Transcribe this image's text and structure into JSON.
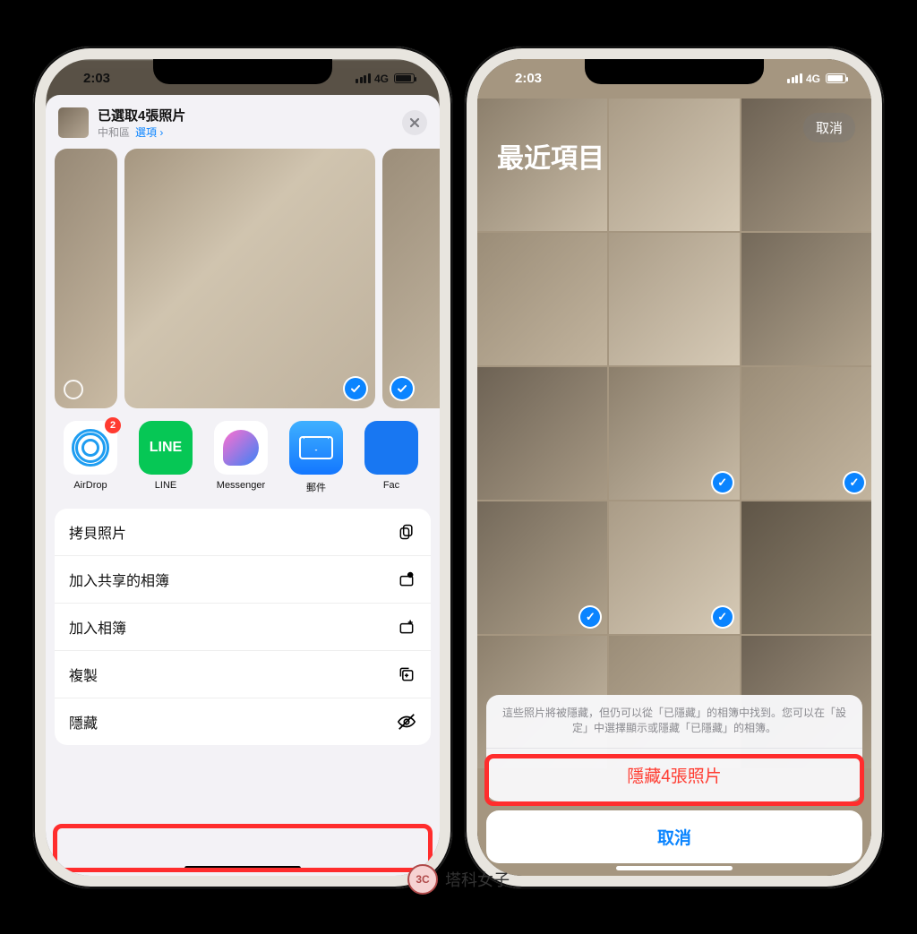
{
  "status": {
    "time": "2:03",
    "network": "4G"
  },
  "phone1": {
    "share": {
      "title": "已選取4張照片",
      "location": "中和區",
      "options_link": "選項 ›"
    },
    "apps": {
      "airdrop": {
        "label": "AirDrop",
        "badge": "2"
      },
      "line": {
        "label": "LINE"
      },
      "messenger": {
        "label": "Messenger"
      },
      "mail": {
        "label": "郵件"
      },
      "facebook": {
        "label": "Fac"
      }
    },
    "actions": {
      "copy_photo": "拷貝照片",
      "add_shared_album": "加入共享的相簿",
      "add_album": "加入相簿",
      "duplicate": "複製",
      "hide": "隱藏"
    }
  },
  "phone2": {
    "album_title": "最近項目",
    "cancel_pill": "取消",
    "sheet": {
      "message": "這些照片將被隱藏，但仍可以從「已隱藏」的相簿中找到。您可以在「設定」中選擇顯示或隱藏「已隱藏」的相簿。",
      "primary": "隱藏4張照片",
      "cancel": "取消"
    }
  },
  "watermark": "塔科女子"
}
